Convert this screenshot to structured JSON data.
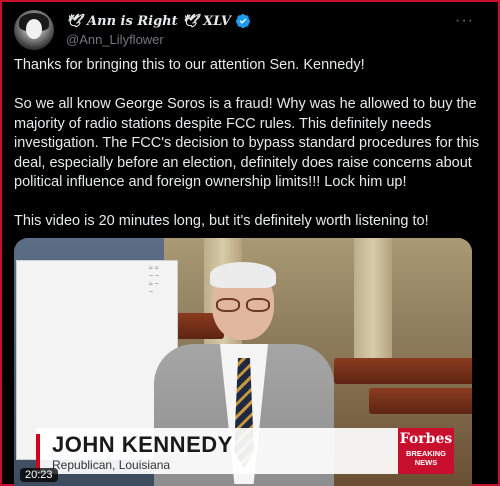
{
  "author": {
    "display_name": "🕊 Ann is Right 🕊 XLV",
    "handle": "@Ann_Lilyflower",
    "verified": true
  },
  "more_button": "···",
  "tweet": {
    "text": "Thanks for bringing this to our attention Sen. Kennedy!\n\nSo we all know George Soros is a fraud! Why was he allowed to buy the majority of radio stations despite FCC rules. This definitely needs investigation. The FCC's decision to bypass standard procedures for this deal, especially before an election, definitely does raise concerns about political influence and foreign ownership limits!!! Lock him up!\n\nThis video is 20 minutes long, but it's definitely worth listening to!"
  },
  "video": {
    "lower_third_name": "JOHN KENNEDY",
    "lower_third_sub": "Republican, Louisiana",
    "brand": "Forbes",
    "brand_tag": "BREAKING NEWS",
    "duration": "20:23"
  },
  "colors": {
    "accent_verified": "#1d9bf0",
    "frame_border": "#c8102e",
    "forbes_red": "#c8102e"
  }
}
